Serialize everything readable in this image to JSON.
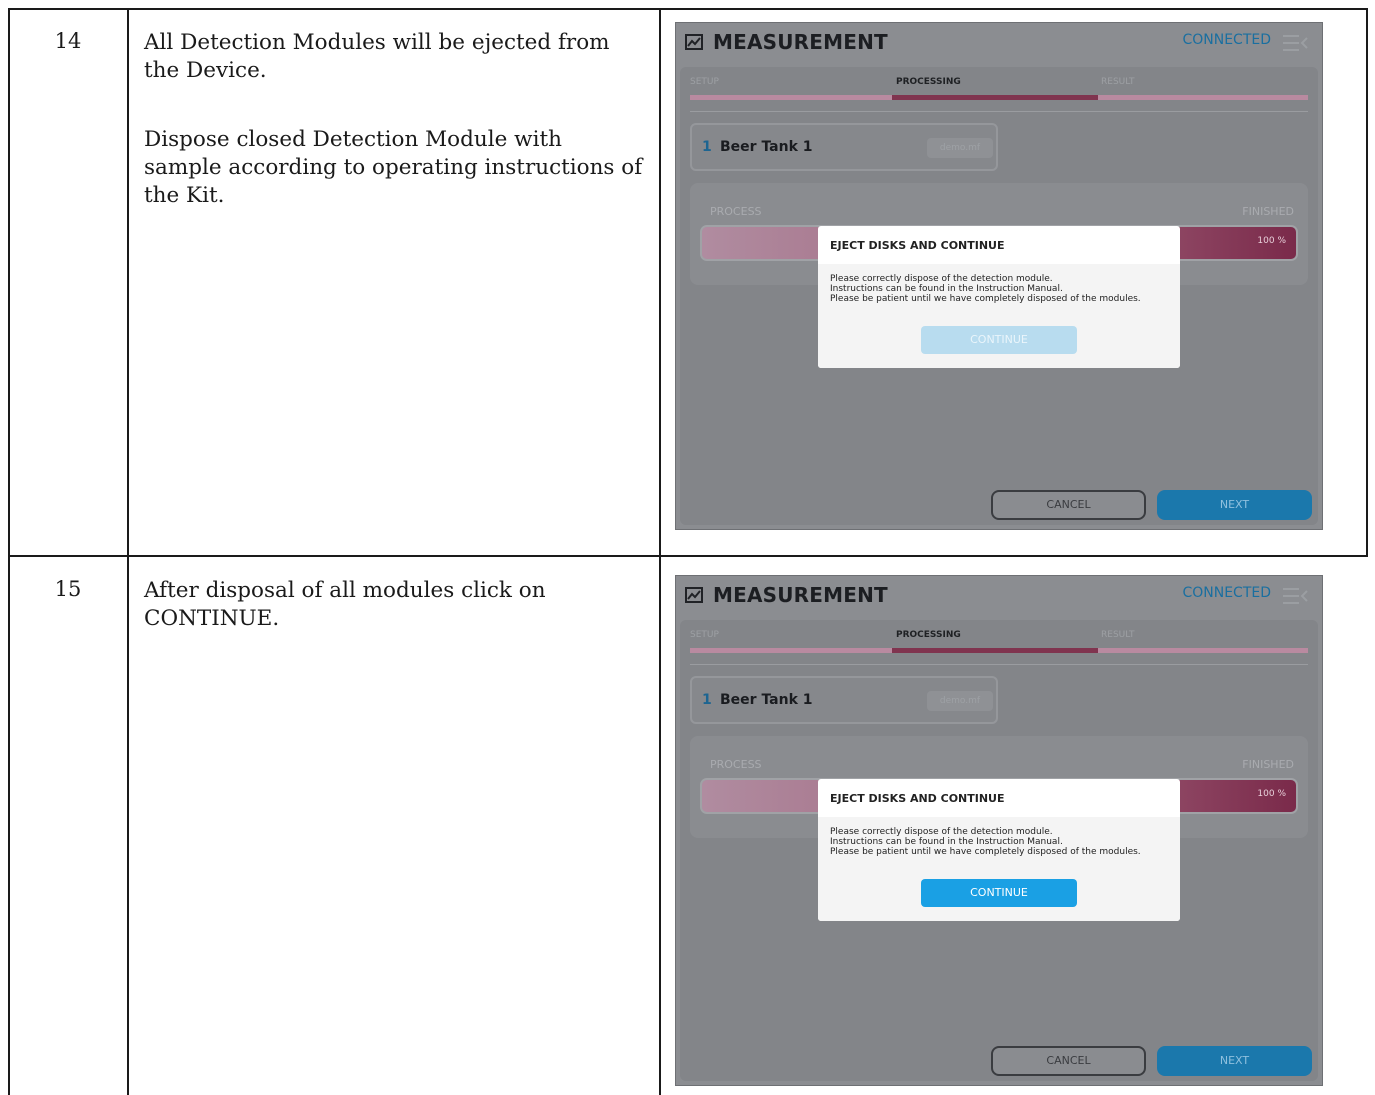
{
  "rows": [
    {
      "number": "14",
      "paragraphs": [
        "All Detection Modules will be ejected from the Device.",
        "Dispose closed Detection Module with sample according to operating instructions of the Kit."
      ],
      "screenshot": {
        "title": "MEASUREMENT",
        "status": "CONNECTED",
        "steps": [
          "SETUP",
          "PROCESSING",
          "RESULT"
        ],
        "sample_index": "1",
        "sample_name": "Beer Tank 1",
        "sample_file": "demo.mf",
        "process_label": "PROCESS",
        "finished_label": "FINISHED",
        "progress_text": "100 %",
        "progress_fraction": 1.0,
        "modal_title": "EJECT DISKS AND CONTINUE",
        "modal_lines": [
          "Please correctly dispose of the detection module.",
          "Instructions can be found in the Instruction Manual.",
          "Please be patient until we have completely disposed of the modules."
        ],
        "continue_label": "CONTINUE",
        "continue_state": "disabled",
        "cancel_label": "CANCEL",
        "next_label": "NEXT"
      }
    },
    {
      "number": "15",
      "paragraphs": [
        "After disposal of all modules click on CONTINUE."
      ],
      "screenshot": {
        "title": "MEASUREMENT",
        "status": "CONNECTED",
        "steps": [
          "SETUP",
          "PROCESSING",
          "RESULT"
        ],
        "sample_index": "1",
        "sample_name": "Beer Tank 1",
        "sample_file": "demo.mf",
        "process_label": "PROCESS",
        "finished_label": "FINISHED",
        "progress_text": "100 %",
        "progress_fraction": 1.0,
        "modal_title": "EJECT DISKS AND CONTINUE",
        "modal_lines": [
          "Please correctly dispose of the detection module.",
          "Instructions can be found in the Instruction Manual.",
          "Please be patient until we have completely disposed of the modules."
        ],
        "continue_label": "CONTINUE",
        "continue_state": "enabled",
        "cancel_label": "CANCEL",
        "next_label": "NEXT"
      }
    }
  ]
}
